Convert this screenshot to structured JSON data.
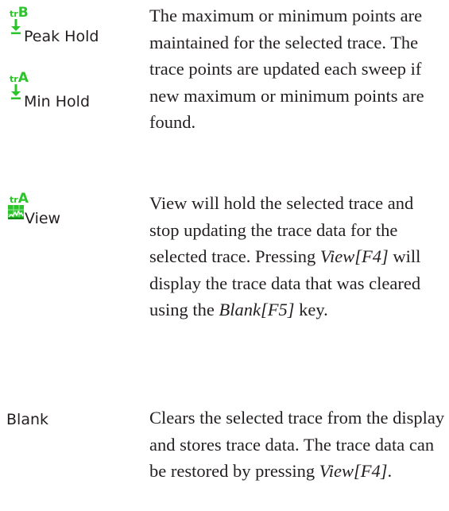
{
  "rows": [
    {
      "labels": [
        {
          "tag_prefix": "tr",
          "tag_letter": "B",
          "text": "Peak Hold"
        },
        {
          "tag_prefix": "tr",
          "tag_letter": "A",
          "text": "Min Hold"
        }
      ],
      "description": "The maximum or minimum points are maintained for the selected trace. The trace points are updated each sweep if new maximum or minimum points are found."
    },
    {
      "label": {
        "tag_prefix": "tr",
        "tag_letter": "A",
        "text": "View"
      },
      "description": {
        "part1": "View will hold the selected trace and stop updating the trace data for the selected trace. Pressing ",
        "em1": "View[F4]",
        "part2": " will display the trace data that was cleared using the ",
        "em2": "Blank[F5]",
        "part3": " key."
      }
    },
    {
      "label": {
        "text": "Blank"
      },
      "description": {
        "part1": "Clears the selected trace from the display and stores trace data. The trace data can be restored by pressing ",
        "em1": "View[F4]",
        "part2": "."
      }
    }
  ],
  "colors": {
    "icon_green": "#2bc42b",
    "text": "#231f20"
  }
}
